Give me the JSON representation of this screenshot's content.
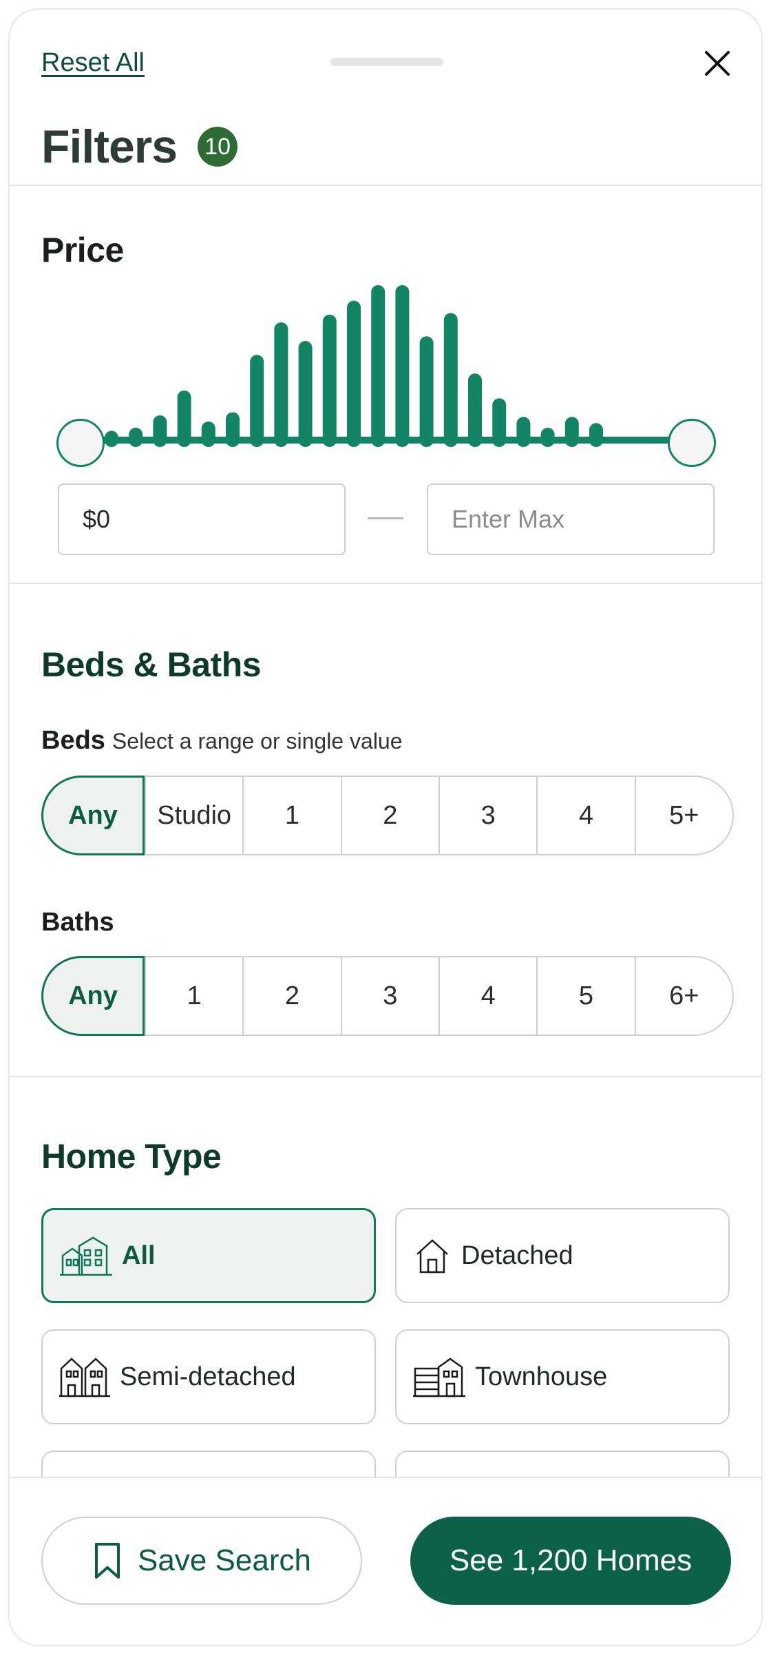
{
  "header": {
    "reset_label": "Reset All",
    "title": "Filters",
    "badge_count": "10"
  },
  "price": {
    "title": "Price",
    "histogram_levels": [
      0.06,
      0.08,
      0.16,
      0.32,
      0.12,
      0.18,
      0.55,
      0.76,
      0.64,
      0.81,
      0.9,
      1.0,
      1.0,
      0.67,
      0.82,
      0.43,
      0.27,
      0.15,
      0.08,
      0.15,
      0.11
    ],
    "min_value": "$0",
    "max_placeholder": "Enter Max"
  },
  "beds_baths": {
    "title": "Beds & Baths",
    "beds_label": "Beds",
    "beds_hint": "Select a range or single value",
    "beds_options": [
      "Any",
      "Studio",
      "1",
      "2",
      "3",
      "4",
      "5+"
    ],
    "baths_label": "Baths",
    "baths_options": [
      "Any",
      "1",
      "2",
      "3",
      "4",
      "5",
      "6+"
    ]
  },
  "home_type": {
    "title": "Home Type",
    "options": [
      {
        "label": "All",
        "icon": "buildings-icon",
        "selected": true
      },
      {
        "label": "Detached",
        "icon": "house-icon",
        "selected": false
      },
      {
        "label": "Semi-detached",
        "icon": "semi-detached-icon",
        "selected": false
      },
      {
        "label": "Townhouse",
        "icon": "townhouse-icon",
        "selected": false
      }
    ]
  },
  "footer": {
    "save_label": "Save Search",
    "see_label": "See 1,200 Homes"
  },
  "colors": {
    "accent": "#138566",
    "primary_button": "#0b6149",
    "badge": "#2e6b35",
    "selected_bg": "#edf2ef"
  }
}
